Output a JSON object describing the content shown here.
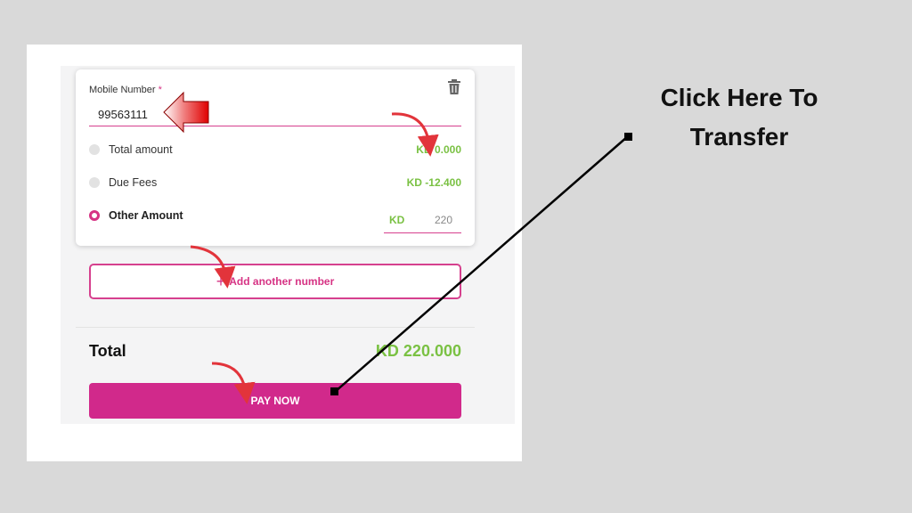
{
  "form": {
    "mobile_label": "Mobile Number",
    "required_mark": "*",
    "mobile_value": "99563111",
    "options": [
      {
        "label": "Total amount",
        "value": "KD 0.000",
        "selected": false
      },
      {
        "label": "Due Fees",
        "value": "KD -12.400",
        "selected": false
      },
      {
        "label": "Other Amount",
        "selected": true
      }
    ],
    "other_amount": {
      "currency": "KD",
      "value": "220"
    },
    "add_number_label": "Add another number",
    "add_icon": "+"
  },
  "summary": {
    "total_label": "Total",
    "total_value": "KD 220.000",
    "pay_label": "PAY NOW"
  },
  "annotation": {
    "line1": "Click Here To",
    "line2": "Transfer"
  },
  "colors": {
    "accent": "#d1298b",
    "amount_green": "#7ac143",
    "annotation_arrow": "#e2343b",
    "pointer_arrow": "#e00000"
  },
  "icons": {
    "delete": "trash-icon",
    "add": "plus-icon"
  }
}
